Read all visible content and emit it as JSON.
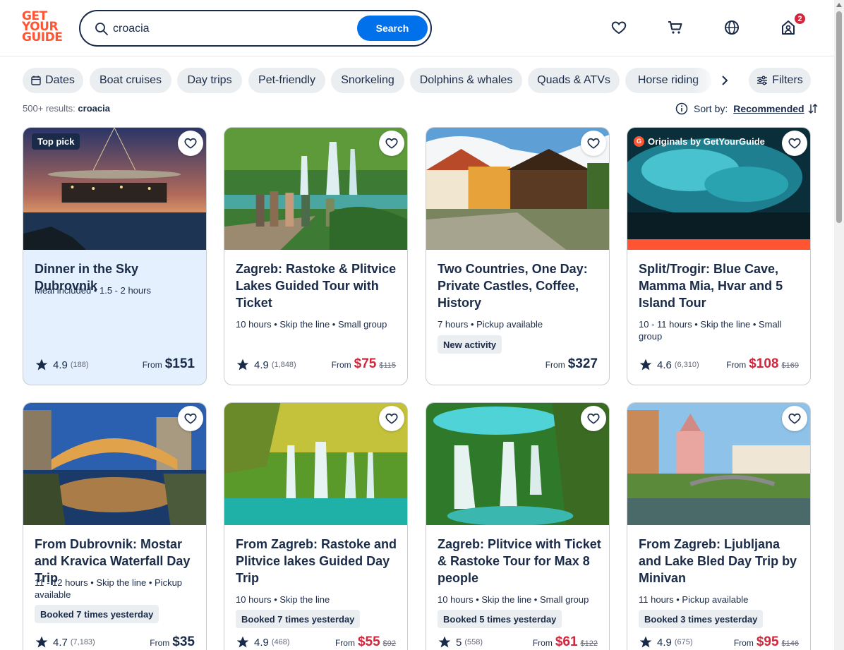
{
  "header": {
    "logo_lines": [
      "GET",
      "YOUR",
      "GUIDE"
    ],
    "search_value": "croacia",
    "search_button": "Search",
    "notification_count": "2"
  },
  "filters": {
    "chips": [
      "Dates",
      "Boat cruises",
      "Day trips",
      "Pet-friendly",
      "Snorkeling",
      "Dolphins & whales",
      "Quads & ATVs",
      "Horse riding"
    ],
    "filters_label": "Filters"
  },
  "results": {
    "count_label": "500+ results:",
    "query": "croacia",
    "sort_label": "Sort by:",
    "sort_value": "Recommended"
  },
  "cards": [
    {
      "title": "Dinner in the Sky Dubrovnik",
      "meta": "Meal included • 1.5 - 2 hours",
      "badge": "",
      "tag": "Top pick",
      "rating": "4.9",
      "reviews": "(188)",
      "from": "From",
      "price": "$151",
      "old_price": ""
    },
    {
      "title": "Zagreb: Rastoke & Plitvice Lakes Guided Tour with Ticket",
      "meta": "10 hours • Skip the line • Small group",
      "badge": "",
      "tag": "",
      "rating": "4.9",
      "reviews": "(1,848)",
      "from": "From",
      "price": "$75",
      "old_price": "$115"
    },
    {
      "title": "Two Countries, One Day: Private Castles, Coffee, History",
      "meta": "7 hours • Pickup available",
      "badge": "New activity",
      "tag": "",
      "rating": "",
      "reviews": "",
      "from": "From",
      "price": "$327",
      "old_price": ""
    },
    {
      "title": "Split/Trogir: Blue Cave, Mamma Mia, Hvar and 5 Island Tour",
      "meta": "10 - 11 hours • Skip the line • Small group",
      "badge": "",
      "tag": "Originals by GetYourGuide",
      "rating": "4.6",
      "reviews": "(6,310)",
      "from": "From",
      "price": "$108",
      "old_price": "$169"
    },
    {
      "title": "From Dubrovnik: Mostar and Kravica Waterfall Day Trip",
      "meta": "11 - 12 hours • Skip the line • Pickup available",
      "badge": "Booked 7 times yesterday",
      "tag": "",
      "rating": "4.7",
      "reviews": "(7,183)",
      "from": "From",
      "price": "$35",
      "old_price": ""
    },
    {
      "title": "From Zagreb: Rastoke and Plitvice lakes Guided Day Trip",
      "meta": "10 hours • Skip the line",
      "badge": "Booked 7 times yesterday",
      "tag": "",
      "rating": "4.9",
      "reviews": "(468)",
      "from": "From",
      "price": "$55",
      "old_price": "$92"
    },
    {
      "title": "Zagreb: Plitvice with Ticket & Rastoke Tour for Max 8 people",
      "meta": "10 hours • Skip the line • Small group",
      "badge": "Booked 5 times yesterday",
      "tag": "",
      "rating": "5",
      "reviews": "(558)",
      "from": "From",
      "price": "$61",
      "old_price": "$122"
    },
    {
      "title": "From Zagreb: Ljubljana and Lake Bled Day Trip by Minivan",
      "meta": "11 hours • Pickup available",
      "badge": "Booked 3 times yesterday",
      "tag": "",
      "rating": "4.9",
      "reviews": "(675)",
      "from": "From",
      "price": "$95",
      "old_price": "$146"
    }
  ],
  "colors": {
    "brand": "#ff5533",
    "navy": "#1a2b49",
    "button_blue": "#0071eb",
    "sale_red": "#d1263c"
  }
}
